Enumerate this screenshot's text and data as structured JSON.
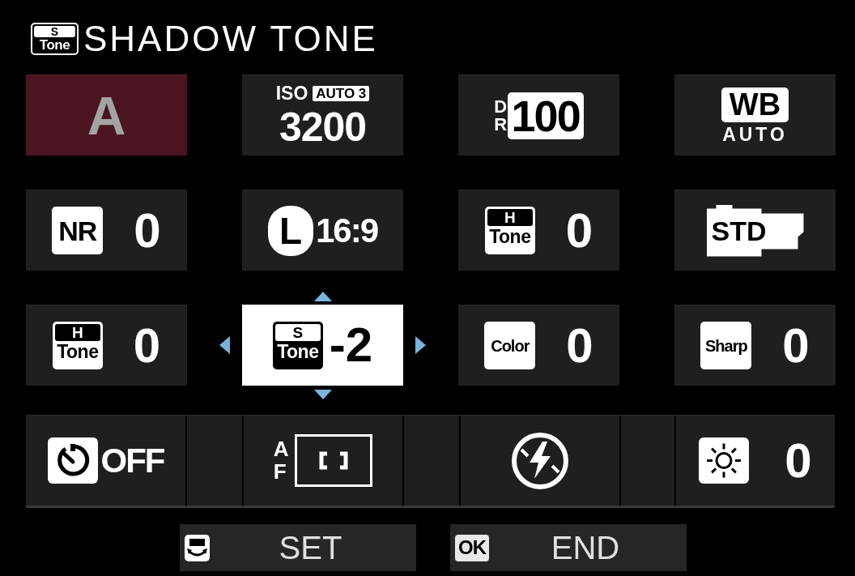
{
  "header": {
    "badge_top": "S",
    "badge_bottom": "Tone",
    "title": "SHADOW TONE"
  },
  "tiles": [
    {
      "kind": "custom",
      "letter": "A",
      "selected": false
    },
    {
      "kind": "iso",
      "label": "ISO",
      "mode": "AUTO 3",
      "value": "3200",
      "selected": false
    },
    {
      "kind": "dynamic_range",
      "label": "DR",
      "value": "100",
      "selected": false
    },
    {
      "kind": "white_balance",
      "label": "WB",
      "value": "AUTO",
      "selected": false
    },
    {
      "kind": "badge",
      "badge": "NR",
      "value": "0",
      "selected": false
    },
    {
      "kind": "image_size",
      "letter": "L",
      "value": "16:9",
      "selected": false
    },
    {
      "kind": "tone",
      "badge_top": "H",
      "badge_bottom": "Tone",
      "value": "0",
      "selected": false
    },
    {
      "kind": "film",
      "value": "STD",
      "selected": false
    },
    {
      "kind": "tone",
      "badge_top": "H",
      "badge_bottom": "Tone",
      "value": "0",
      "selected": false
    },
    {
      "kind": "tone",
      "badge_top": "S",
      "badge_bottom": "Tone",
      "value": "-2",
      "selected": true
    },
    {
      "kind": "badge",
      "badge": "Color",
      "value": "0",
      "selected": false
    },
    {
      "kind": "badge",
      "badge": "Sharp",
      "value": "0",
      "selected": false
    }
  ],
  "bottom_bar": {
    "items": [
      {
        "kind": "timer",
        "value": "OFF",
        "selected": false
      },
      {
        "kind": "af",
        "label": "AF",
        "selected": false
      },
      {
        "kind": "flash",
        "selected": false
      },
      {
        "kind": "brightness",
        "value": "0",
        "selected": false
      }
    ]
  },
  "footer": [
    {
      "kind": "dial",
      "label": "SET"
    },
    {
      "kind": "key",
      "key": "OK",
      "label": "END"
    }
  ]
}
